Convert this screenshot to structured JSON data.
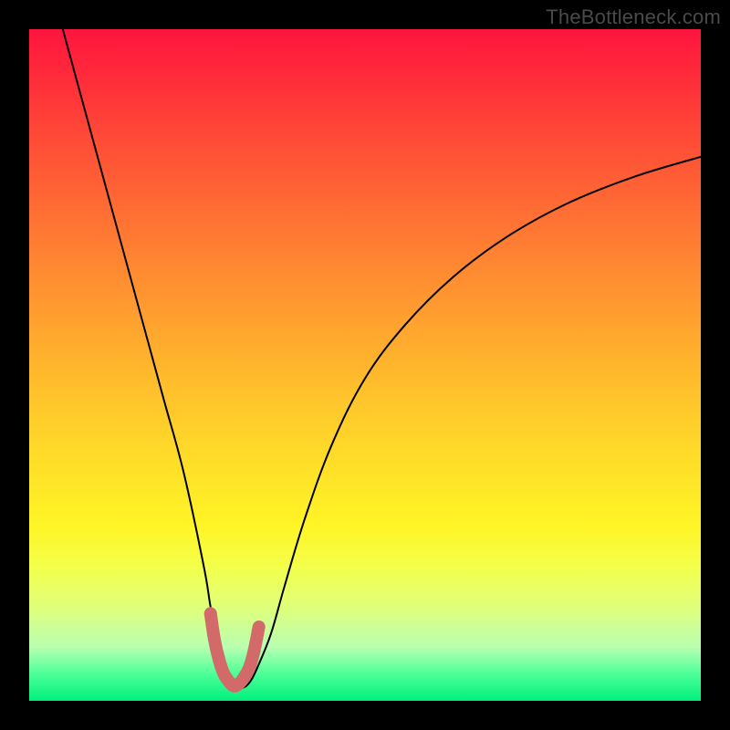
{
  "watermark": "TheBottleneck.com",
  "chart_data": {
    "type": "line",
    "title": "",
    "xlabel": "",
    "ylabel": "",
    "xlim": [
      0,
      100
    ],
    "ylim": [
      0,
      100
    ],
    "series": [
      {
        "name": "bottleneck-curve",
        "color": "#000000",
        "stroke_width": 2,
        "x": [
          5,
          8,
          11,
          14,
          17,
          20,
          23,
          26,
          27,
          28,
          29,
          30,
          31,
          32,
          33,
          34,
          36,
          38,
          41,
          45,
          50,
          56,
          63,
          71,
          80,
          90,
          100
        ],
        "y": [
          100,
          89,
          78,
          67,
          56,
          45,
          34,
          20,
          14,
          9,
          5,
          3,
          2,
          2,
          3,
          5,
          10,
          17,
          27,
          38,
          48,
          56,
          63,
          69,
          74,
          78,
          81
        ]
      },
      {
        "name": "highlight-valley",
        "color": "#d36a6a",
        "stroke_width": 14,
        "x": [
          27.0,
          27.6,
          28.3,
          29.0,
          29.8,
          30.5,
          31.2,
          32.0,
          32.8,
          33.5,
          34.2
        ],
        "y": [
          13.0,
          9.0,
          6.0,
          4.0,
          2.8,
          2.2,
          2.5,
          3.5,
          5.0,
          7.5,
          11.0
        ]
      }
    ]
  }
}
